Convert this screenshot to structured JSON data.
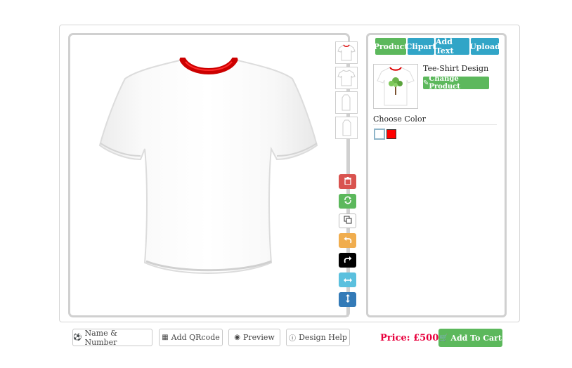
{
  "tabs": [
    {
      "label": "Product",
      "color": "#5cb85c"
    },
    {
      "label": "Clipart",
      "color": "#31a5c7"
    },
    {
      "label": "Add Text",
      "color": "#31a5c7"
    },
    {
      "label": "Upload",
      "color": "#31a5c7"
    }
  ],
  "product": {
    "name": "Tee-Shirt Design",
    "change_label": "Change Product",
    "change_icon": "edit-icon"
  },
  "color_section": {
    "title": "Choose Color",
    "swatches": [
      "#ffffff",
      "#ff0000"
    ],
    "selected": "#ffffff"
  },
  "tools": [
    {
      "name": "delete",
      "icon": "trash-icon",
      "color": "#d9534f"
    },
    {
      "name": "reset",
      "icon": "refresh-icon",
      "color": "#5cb85c"
    },
    {
      "name": "duplicate",
      "icon": "copy-icon",
      "color": "#ffffff"
    },
    {
      "name": "undo",
      "icon": "undo-icon",
      "color": "#f0ad4e"
    },
    {
      "name": "redo",
      "icon": "redo-icon",
      "color": "#000000"
    },
    {
      "name": "flip-horizontal",
      "icon": "arrows-h-icon",
      "color": "#5bc0de"
    },
    {
      "name": "flip-vertical",
      "icon": "arrows-v-icon",
      "color": "#337ab7"
    }
  ],
  "bottom": {
    "name_number": "Name & Number",
    "qrcode": "Add QRcode",
    "preview": "Preview",
    "design_help": "Design Help",
    "price": "Price: £500",
    "add_to_cart": "Add To Cart"
  },
  "shirt": {
    "body_color": "#ffffff",
    "collar_color": "#d80000"
  }
}
